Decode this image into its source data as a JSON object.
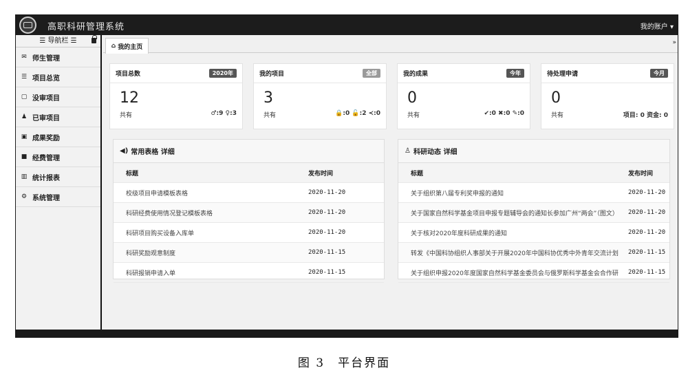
{
  "app": {
    "title": "高职科研管理系统",
    "account": "我的账户 ▾"
  },
  "sidebar": {
    "header": "☰ 导航栏 ☰",
    "items": [
      {
        "label": "师生管理",
        "icon": "mail-icon"
      },
      {
        "label": "项目总览",
        "icon": "list-icon"
      },
      {
        "label": "没审项目",
        "icon": "file-icon"
      },
      {
        "label": "已审项目",
        "icon": "users-icon"
      },
      {
        "label": "成果奖励",
        "icon": "card-icon"
      },
      {
        "label": "经费管理",
        "icon": "square-icon"
      },
      {
        "label": "统计报表",
        "icon": "bar-chart-icon"
      },
      {
        "label": "系统管理",
        "icon": "gears-icon"
      }
    ]
  },
  "tabs": {
    "home": "我的主页",
    "more": "»"
  },
  "cards": [
    {
      "title": "项目总数",
      "badge": "2020年",
      "value": "12",
      "sub": "共有",
      "stats": "♂:9 ♀:3"
    },
    {
      "title": "我的项目",
      "badge": "全部",
      "value": "3",
      "sub": "共有",
      "stats": "🔒:0 🔓:2 ≺:0"
    },
    {
      "title": "我的成果",
      "badge": "今年",
      "value": "0",
      "sub": "共有",
      "stats": "✔:0 ✖:0 ✎:0"
    },
    {
      "title": "待处理申请",
      "badge": "今月",
      "value": "0",
      "sub": "共有",
      "stats": "项目: 0 资金: 0"
    }
  ],
  "forms_panel": {
    "title": "常用表格 详细",
    "col_title": "标题",
    "col_date": "发布时间",
    "rows": [
      {
        "title": "校级项目申请模板表格",
        "date": "2020-11-20"
      },
      {
        "title": "科研经费使用情况登记模板表格",
        "date": "2020-11-20"
      },
      {
        "title": "科研项目购买设备入库单",
        "date": "2020-11-20"
      },
      {
        "title": "科研奖励观意制度",
        "date": "2020-11-15"
      },
      {
        "title": "科研报销申请入单",
        "date": "2020-11-15"
      }
    ]
  },
  "news_panel": {
    "title": "科研动态 详细",
    "col_title": "标题",
    "col_date": "发布时间",
    "rows": [
      {
        "title": "关于组织第八届专利奖申报的通知",
        "date": "2020-11-20"
      },
      {
        "title": "关于国家自然科学基金项目申报专题辅导会的通知长参加广州“两会”（图文）",
        "date": "2020-11-20"
      },
      {
        "title": "关于核对2020年度科研成果的通知",
        "date": "2020-11-20"
      },
      {
        "title": "转发《中国科协组织人事部关于开展2020年中国科协优秀中外青年交流计划",
        "date": "2020-11-15"
      },
      {
        "title": "关于组织申报2020年度国家自然科学基金委员会与俄罗斯科学基金会合作研",
        "date": "2020-11-15"
      }
    ]
  },
  "caption": "图 3　平台界面"
}
